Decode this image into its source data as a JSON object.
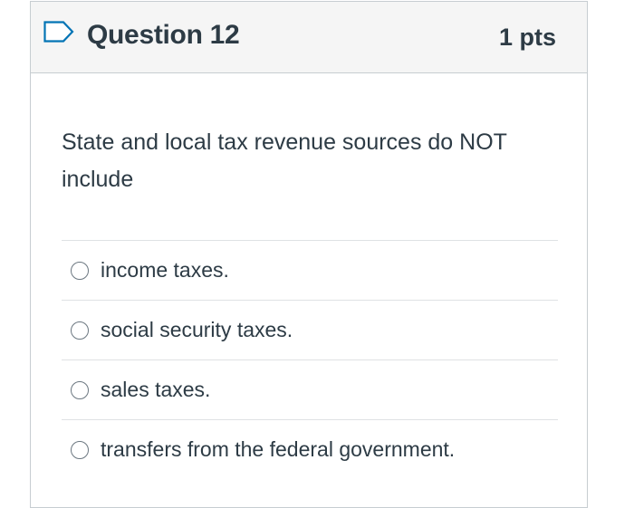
{
  "question": {
    "title": "Question 12",
    "points": "1 pts",
    "text": "State and local tax revenue sources do NOT include",
    "flag_icon": "flag-outline-icon",
    "accent_color": "#0374b5"
  },
  "answers": [
    {
      "label": "income taxes.",
      "selected": false
    },
    {
      "label": "social security taxes.",
      "selected": false
    },
    {
      "label": "sales taxes.",
      "selected": false
    },
    {
      "label": "transfers from the federal government.",
      "selected": false
    }
  ]
}
